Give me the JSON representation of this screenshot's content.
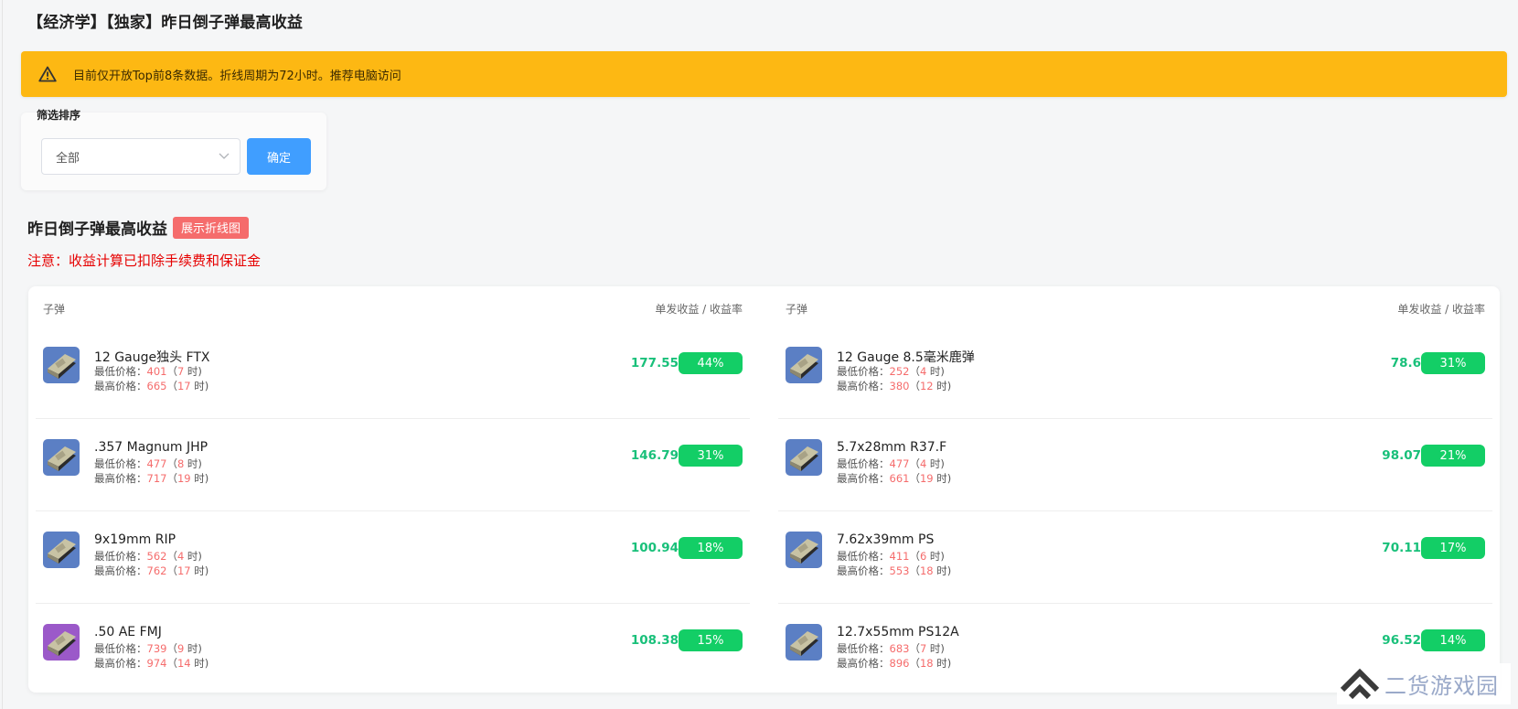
{
  "page": {
    "title": "【经济学】【独家】昨日倒子弹最高收益"
  },
  "alert": {
    "icon": "warning-icon",
    "text": "目前仅开放Top前8条数据。折线周期为72小时。推荐电脑访问",
    "color": "#fdb813"
  },
  "filter": {
    "label": "筛选排序",
    "select_value": "全部",
    "confirm_label": "确定"
  },
  "section": {
    "title": "昨日倒子弹最高收益",
    "chart_button": "展示折线图",
    "note": "注意：收益计算已扣除手续费和保证金"
  },
  "table": {
    "col_ammo": "子弹",
    "col_profit": "单发收益 / 收益率",
    "label_min": "最低价格：",
    "label_max": "最高价格：",
    "hour_suffix": " 时)",
    "left": [
      {
        "name": "12 Gauge独头 FTX",
        "min_price": "401",
        "min_hour": "7",
        "max_price": "665",
        "max_hour": "17",
        "profit": "177.55",
        "rate": "44%",
        "icon": "ammo-box-icon",
        "icon_color": "#5b7fc4"
      },
      {
        "name": ".357 Magnum JHP",
        "min_price": "477",
        "min_hour": "8",
        "max_price": "717",
        "max_hour": "19",
        "profit": "146.79",
        "rate": "31%",
        "icon": "ammo-box-icon",
        "icon_color": "#5b7fc4"
      },
      {
        "name": "9x19mm RIP",
        "min_price": "562",
        "min_hour": "4",
        "max_price": "762",
        "max_hour": "17",
        "profit": "100.94",
        "rate": "18%",
        "icon": "ammo-box-icon",
        "icon_color": "#5b7fc4"
      },
      {
        "name": ".50 AE FMJ",
        "min_price": "739",
        "min_hour": "9",
        "max_price": "974",
        "max_hour": "14",
        "profit": "108.38",
        "rate": "15%",
        "icon": "ammo-box-icon",
        "icon_color": "#9b59c9"
      }
    ],
    "right": [
      {
        "name": "12 Gauge 8.5毫米鹿弹",
        "min_price": "252",
        "min_hour": "4",
        "max_price": "380",
        "max_hour": "12",
        "profit": "78.6",
        "rate": "31%",
        "icon": "ammo-box-icon",
        "icon_color": "#5b7fc4"
      },
      {
        "name": "5.7x28mm R37.F",
        "min_price": "477",
        "min_hour": "4",
        "max_price": "661",
        "max_hour": "19",
        "profit": "98.07",
        "rate": "21%",
        "icon": "ammo-box-icon",
        "icon_color": "#5b7fc4"
      },
      {
        "name": "7.62x39mm PS",
        "min_price": "411",
        "min_hour": "6",
        "max_price": "553",
        "max_hour": "18",
        "profit": "70.11",
        "rate": "17%",
        "icon": "ammo-box-icon",
        "icon_color": "#5b7fc4"
      },
      {
        "name": "12.7x55mm PS12A",
        "min_price": "683",
        "min_hour": "7",
        "max_price": "896",
        "max_hour": "18",
        "profit": "96.52",
        "rate": "14%",
        "icon": "ammo-box-icon",
        "icon_color": "#5b7fc4"
      }
    ]
  },
  "watermark": {
    "text": "二货游戏园",
    "icon": "site-logo-icon"
  }
}
